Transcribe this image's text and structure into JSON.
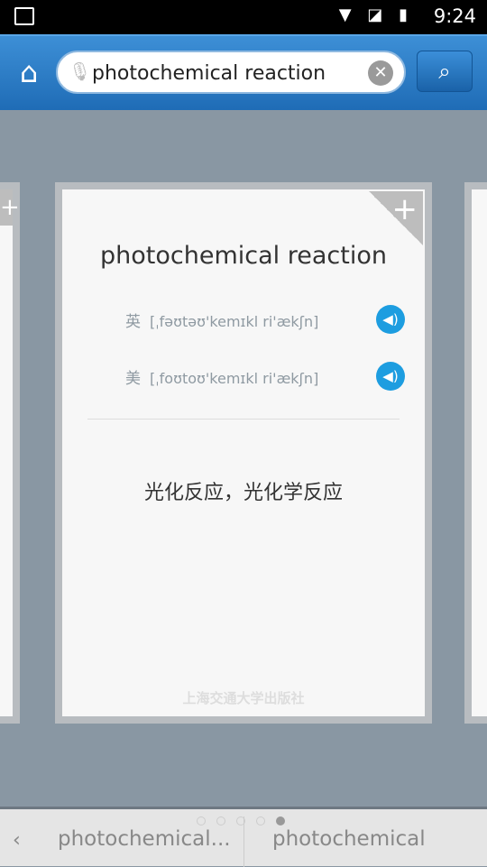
{
  "status": {
    "time": "9:24"
  },
  "search": {
    "value": "photochemical reaction"
  },
  "card": {
    "word": "photochemical reaction",
    "uk_label": "英",
    "uk_phonetic": "[ˌfəʊtəʊ'kemɪkl ri'ækʃn]",
    "us_label": "美",
    "us_phonetic": "[ˌfoʊtoʊ'kemɪkl ri'ækʃn]",
    "definition": "光化反应，光化学反应",
    "publisher": "上海交通大学出版社"
  },
  "pager": {
    "count": 5,
    "active": 4
  },
  "history": [
    "photochemical...",
    "photochemical"
  ]
}
